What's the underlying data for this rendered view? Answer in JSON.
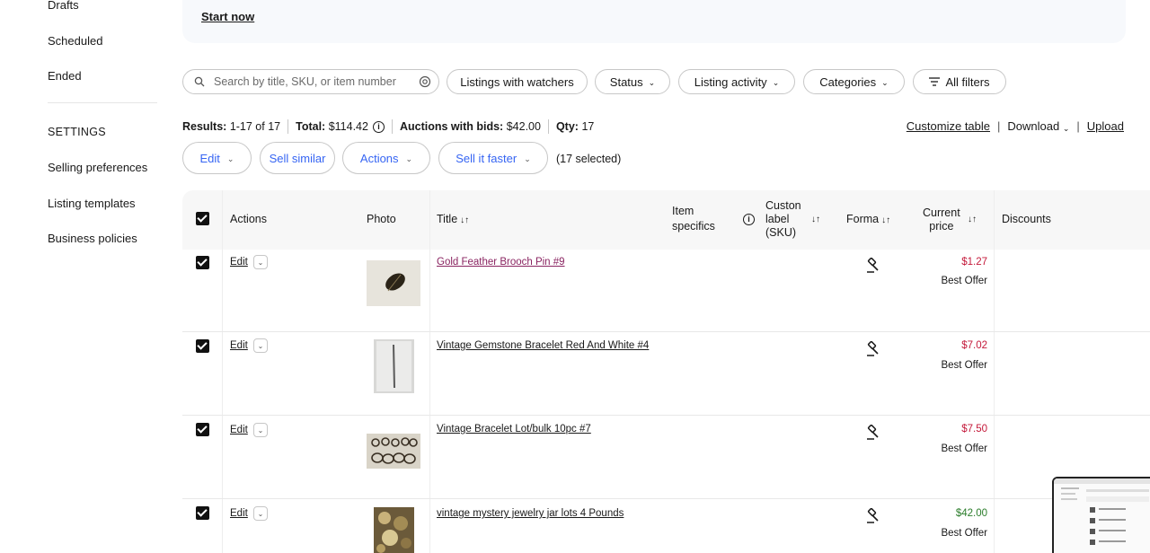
{
  "sidebar": {
    "items": [
      {
        "label": "Drafts"
      },
      {
        "label": "Scheduled"
      },
      {
        "label": "Ended"
      }
    ],
    "settings_heading": "SETTINGS",
    "settings_items": [
      {
        "label": "Selling preferences"
      },
      {
        "label": "Listing templates"
      },
      {
        "label": "Business policies"
      }
    ]
  },
  "banner": {
    "start_now": "Start now"
  },
  "filters": {
    "search_placeholder": "Search by title, SKU, or item number",
    "watchers": "Listings with watchers",
    "status": "Status",
    "listing_activity": "Listing activity",
    "categories": "Categories",
    "all_filters": "All filters"
  },
  "results": {
    "results_label": "Results:",
    "results_value": "1-17 of 17",
    "total_label": "Total:",
    "total_value": "$114.42",
    "auctions_label": "Auctions with bids:",
    "auctions_value": "$42.00",
    "qty_label": "Qty:",
    "qty_value": "17"
  },
  "right_links": {
    "customize": "Customize table",
    "download": "Download",
    "upload": "Upload"
  },
  "actions": {
    "edit": "Edit",
    "sell_similar": "Sell similar",
    "actions": "Actions",
    "sell_faster": "Sell it faster",
    "selected": "(17 selected)"
  },
  "table": {
    "headers": {
      "actions": "Actions",
      "photo": "Photo",
      "title": "Title",
      "item_specifics_1": "Item",
      "item_specifics_2": "specifics",
      "custom_1": "Custon",
      "custom_2": "label",
      "custom_3": "(SKU)",
      "format": "Forma",
      "price_1": "Current",
      "price_2": "price",
      "discounts": "Discounts"
    },
    "rows": [
      {
        "edit": "Edit",
        "title": "Gold Feather Brooch Pin #9",
        "price": "$1.27",
        "offer": "Best Offer"
      },
      {
        "edit": "Edit",
        "title": "Vintage Gemstone Bracelet Red And White #4",
        "price": "$7.02",
        "offer": "Best Offer"
      },
      {
        "edit": "Edit",
        "title": "Vintage Bracelet Lot/bulk 10pc #7",
        "price": "$7.50",
        "offer": "Best Offer"
      },
      {
        "edit": "Edit",
        "title": "vintage mystery jewelry jar lots 4 Pounds",
        "price": "$42.00",
        "offer": "Best Offer"
      }
    ]
  },
  "colors": {
    "accent_blue": "#3665f3",
    "price_red": "#c4193a",
    "price_green": "#2b7d2b",
    "visited_link": "#8a2461"
  }
}
